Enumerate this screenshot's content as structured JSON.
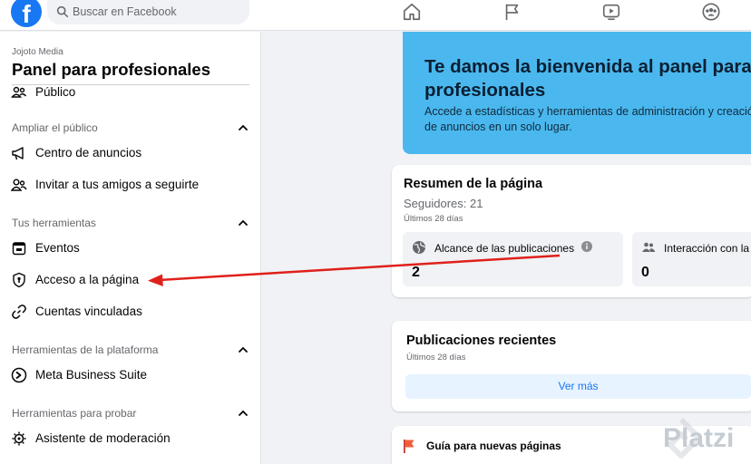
{
  "topbar": {
    "logo": "f",
    "search_placeholder": "Buscar en Facebook",
    "nav_icons": [
      "home-icon",
      "flag-icon",
      "video-icon",
      "groups-icon"
    ]
  },
  "sidebar": {
    "page_name": "Jojoto Media",
    "title": "Panel para profesionales",
    "top_item": "Público",
    "sections": [
      {
        "title": "Ampliar el público",
        "items": [
          "Centro de anuncios",
          "Invitar a tus amigos a seguirte"
        ]
      },
      {
        "title": "Tus herramientas",
        "items": [
          "Eventos",
          "Acceso a la página",
          "Cuentas vinculadas"
        ]
      },
      {
        "title": "Herramientas de la plataforma",
        "items": [
          "Meta Business Suite"
        ]
      },
      {
        "title": "Herramientas para probar",
        "items": [
          "Asistente de moderación"
        ]
      }
    ]
  },
  "welcome": {
    "title_line1": "Te damos la bienvenida al panel para",
    "title_line2": "profesionales",
    "desc_line1": "Accede a estadísticas y herramientas de administración y creación",
    "desc_line2": "de anuncios en un solo lugar."
  },
  "summary": {
    "title": "Resumen de la página",
    "followers": "Seguidores: 21",
    "period": "Últimos 28 días",
    "metrics": [
      {
        "label": "Alcance de las publicaciones",
        "value": "2"
      },
      {
        "label": "Interacción con la página",
        "value": "0"
      }
    ]
  },
  "recent": {
    "title": "Publicaciones recientes",
    "period": "Últimos 28 días",
    "more_label": "Ver más"
  },
  "guide": {
    "label": "Guía para nuevas páginas"
  },
  "watermark": "Platzi",
  "colors": {
    "brand": "#1877f2",
    "welcome_bg": "#4ab8ee",
    "annotation_arrow": "#e0201b"
  }
}
